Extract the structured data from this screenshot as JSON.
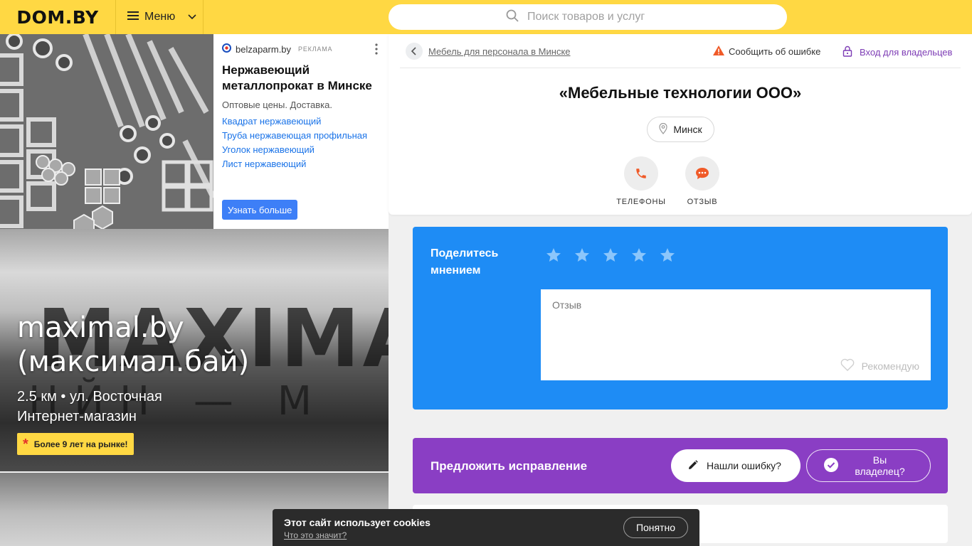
{
  "header": {
    "logo": "DOM.BY",
    "menu_label": "Меню",
    "search_placeholder": "Поиск товаров и услуг"
  },
  "ad": {
    "source": "belzaparm.by",
    "label": "РЕКЛАМА",
    "title": "Нержавеющий металлопрокат в Минске",
    "description": "Оптовые цены. Доставка.",
    "links": [
      "Квадрат нержавеющий",
      "Труба нержавеющая профильная",
      "Уголок нержавеющий",
      "Лист нержавеющий"
    ],
    "cta": "Узнать больше"
  },
  "promo": {
    "bg_text": "MAXIMA",
    "bg_subtext": "НЙН — М",
    "title_line1": "maximal.by",
    "title_line2": "(максимал.бай)",
    "address": "2.5 км • ул. Восточная",
    "category": "Интернет-магазин",
    "badge": "Более 9 лет на рынке!"
  },
  "company": {
    "breadcrumb": "Мебель для персонала в Минске",
    "report_error": "Сообщить об ошибке",
    "owner_login": "Вход для владельцев",
    "name": "«Мебельные технологии ООО»",
    "city": "Минск",
    "actions": {
      "phones": "ТЕЛЕФОНЫ",
      "review": "ОТЗЫВ"
    }
  },
  "review": {
    "title": "Поделитесь мнением",
    "stars_count": 5,
    "rating": 0,
    "placeholder": "Отзыв",
    "recommend": "Рекомендую"
  },
  "suggest": {
    "title": "Предложить исправление",
    "found_error": "Нашли ошибку?",
    "are_owner": "Вы владелец?"
  },
  "cookie": {
    "text": "Этот сайт использует cookies",
    "link": "Что это значит?",
    "button": "Понятно"
  },
  "colors": {
    "header_bg": "#ffd843",
    "review_bg": "#1e8cf5",
    "suggest_bg": "#8a3ec4",
    "accent_orange": "#f05a28",
    "owner_link": "#7d3cb5"
  }
}
